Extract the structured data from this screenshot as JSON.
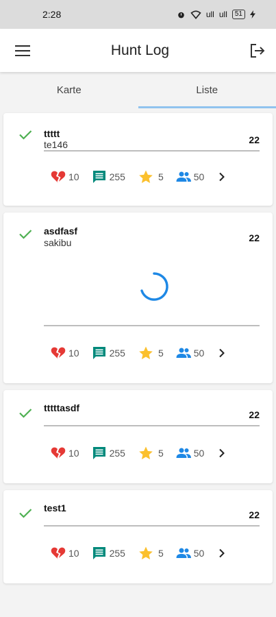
{
  "status": {
    "time": "2:28",
    "signal1": "ull",
    "signal2": "ull",
    "battery": "51"
  },
  "appbar": {
    "title": "Hunt Log"
  },
  "tabs": [
    {
      "label": "Karte"
    },
    {
      "label": "Liste"
    }
  ],
  "active_tab": "Liste",
  "colors": {
    "check": "#4caf50",
    "heart": "#e53935",
    "comment": "#00897b",
    "star": "#fbc02d",
    "group": "#1e88e5",
    "spinner": "#1e88e5",
    "tab_indicator": "#90c3ee"
  },
  "icons": {
    "menu": "menu-icon",
    "logout": "logout-icon",
    "check": "check-icon",
    "broken_heart": "heart-broken-icon",
    "comment": "comment-icon",
    "star": "star-icon",
    "group": "group-icon",
    "chevron": "chevron-right-icon"
  },
  "cards": [
    {
      "title": "ttttt",
      "subtitle": "te146",
      "count": "22",
      "broken": "10",
      "comments": "255",
      "stars": "5",
      "people": "50",
      "loading": false
    },
    {
      "title": "asdfasf",
      "subtitle": "sakibu",
      "count": "22",
      "broken": "10",
      "comments": "255",
      "stars": "5",
      "people": "50",
      "loading": true
    },
    {
      "title": "tttttasdf",
      "subtitle": "",
      "count": "22",
      "broken": "10",
      "comments": "255",
      "stars": "5",
      "people": "50",
      "loading": false
    },
    {
      "title": "test1",
      "subtitle": "",
      "count": "22",
      "broken": "10",
      "comments": "255",
      "stars": "5",
      "people": "50",
      "loading": false
    }
  ]
}
